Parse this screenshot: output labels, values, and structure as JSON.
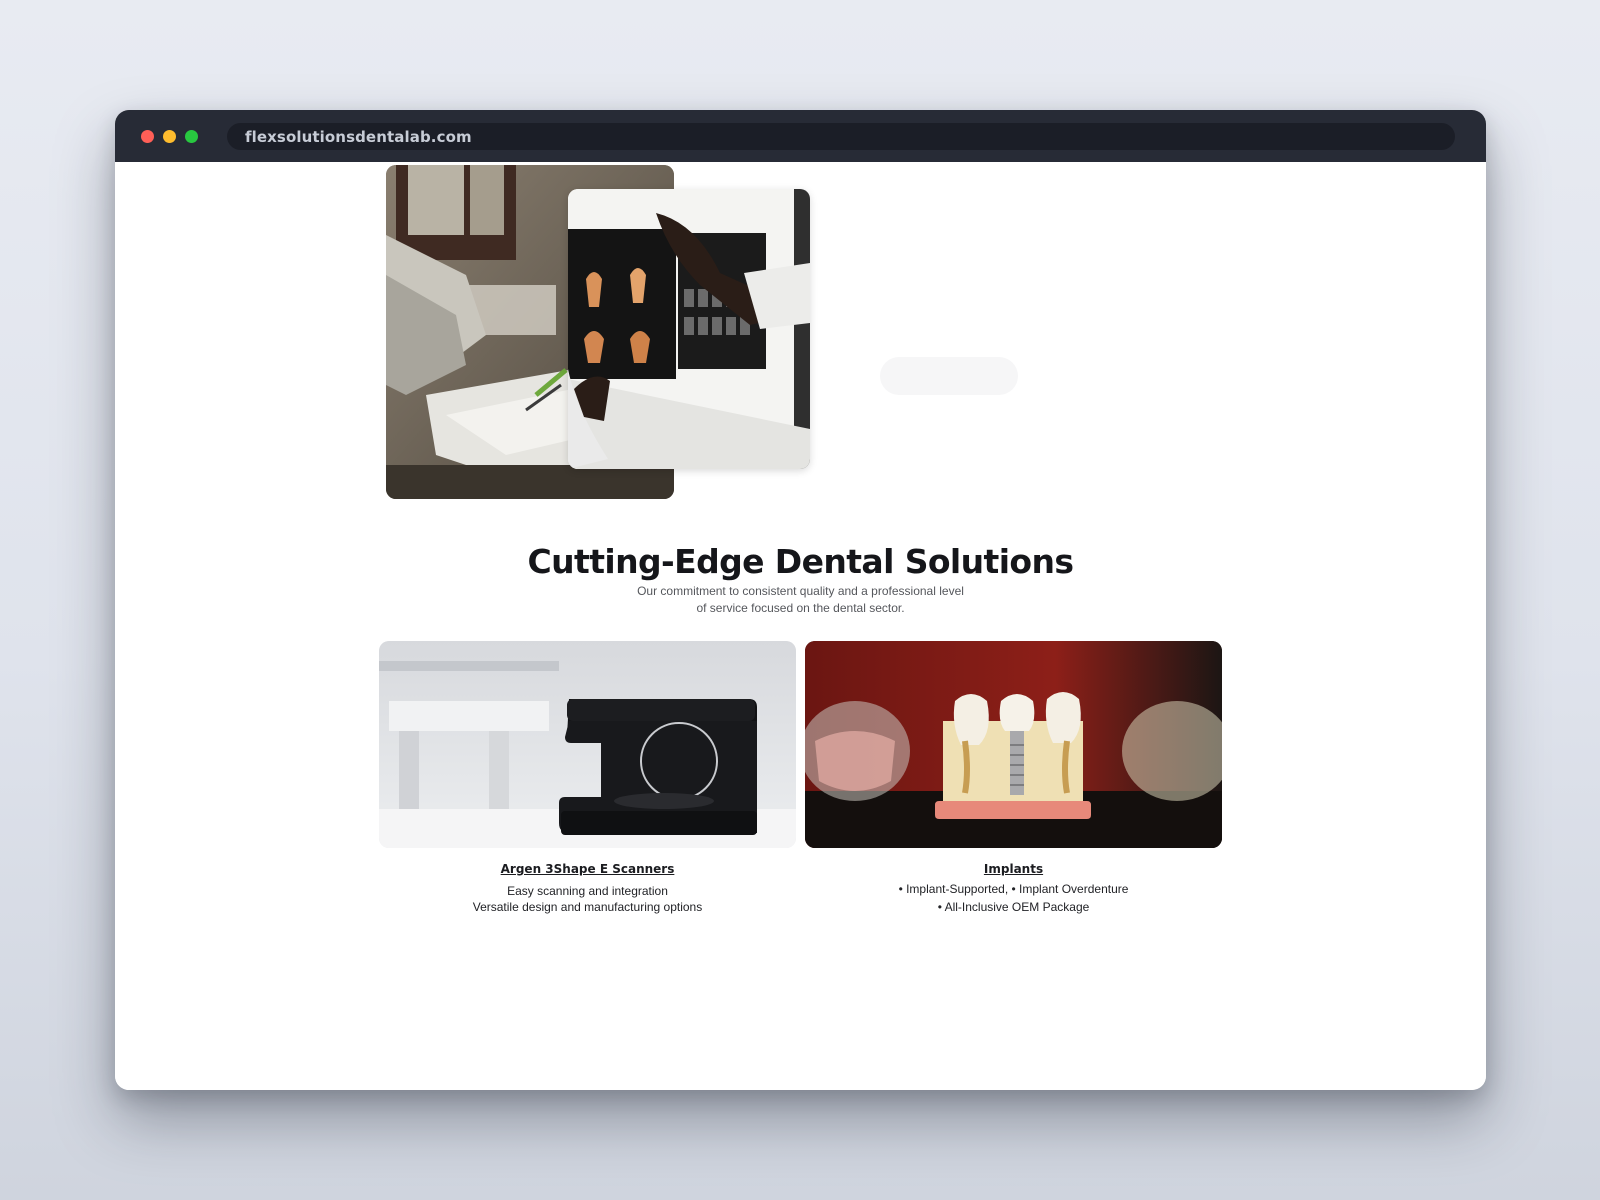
{
  "browser": {
    "url": "flexsolutionsdentalab.com",
    "controls": [
      "close",
      "minimize",
      "maximize"
    ]
  },
  "hero": {
    "back_photo": "dental-chair-tools-photo",
    "front_photo": "dental-x-ray-review-photo",
    "button_label": ""
  },
  "section": {
    "title": "Cutting-Edge Dental Solutions",
    "subtitle_line1": "Our commitment to consistent quality and a professional level",
    "subtitle_line2": "of service focused on the dental sector."
  },
  "cards": [
    {
      "title": "Argen 3Shape E Scanners",
      "lines": [
        "Easy scanning and integration",
        "Versatile design and manufacturing options"
      ],
      "image": "dental-scanner-photo"
    },
    {
      "title": "Implants",
      "lines": [
        "• Implant-Supported, • Implant Overdenture",
        "• All-Inclusive OEM Package"
      ],
      "image": "dental-implant-model-photo"
    }
  ]
}
